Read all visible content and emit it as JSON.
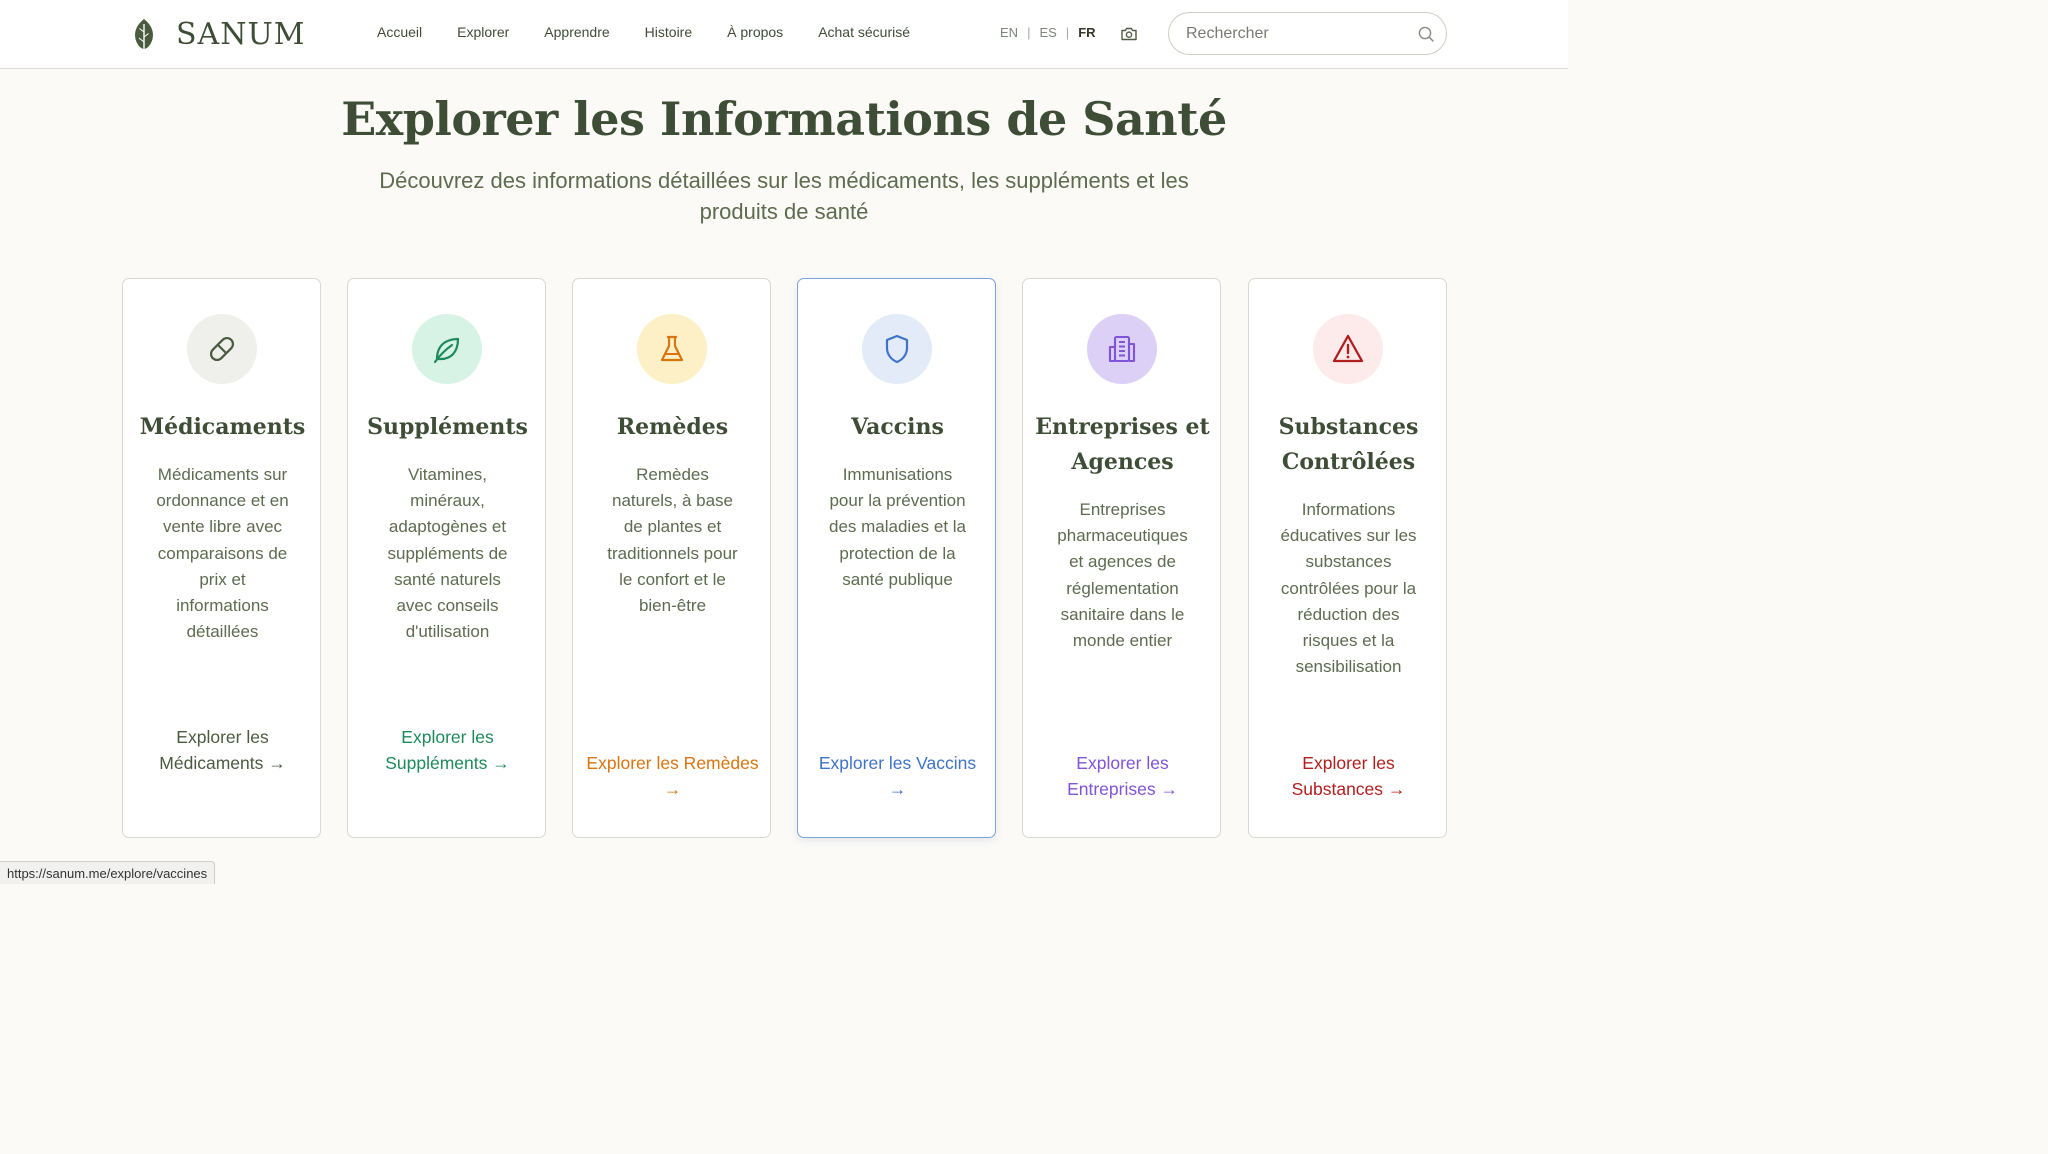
{
  "brand": {
    "name": "SANUM"
  },
  "nav": [
    {
      "label": "Accueil"
    },
    {
      "label": "Explorer"
    },
    {
      "label": "Apprendre"
    },
    {
      "label": "Histoire"
    },
    {
      "label": "À propos"
    },
    {
      "label": "Achat sécurisé"
    }
  ],
  "languages": {
    "en": "EN",
    "es": "ES",
    "fr": "FR",
    "sep": "|",
    "active": "FR"
  },
  "search": {
    "placeholder": "Rechercher",
    "value": ""
  },
  "hero": {
    "title": "Explorer les Informations de Santé",
    "subtitle": "Découvrez des informations détaillées sur les médicaments, les suppléments et les produits de santé"
  },
  "cards": [
    {
      "title": "Médicaments",
      "description": "Médicaments sur ordonnance et en vente libre avec comparaisons de prix et informations détaillées",
      "link": "Explorer les Médicaments →",
      "icon": "pill-icon",
      "color": "#4a5b3f",
      "icon_bg": "#efefec"
    },
    {
      "title": "Suppléments",
      "description": "Vitamines, minéraux, adaptogènes et suppléments de santé naturels avec conseils d'utilisation",
      "link": "Explorer les Suppléments →",
      "icon": "leaf-icon",
      "color": "#1d8a5c",
      "icon_bg": "#d6f3e5"
    },
    {
      "title": "Remèdes",
      "description": "Remèdes naturels, à base de plantes et traditionnels pour le confort et le bien-être",
      "link": "Explorer les Remèdes →",
      "icon": "flask-icon",
      "color": "#d9740f",
      "icon_bg": "#fdf0c6"
    },
    {
      "title": "Vaccins",
      "description": "Immunisations pour la prévention des maladies et la protection de la santé publique",
      "link": "Explorer les Vaccins →",
      "icon": "shield-icon",
      "color": "#3f73c8",
      "icon_bg": "#e3ebf9"
    },
    {
      "title": "Entreprises et Agences",
      "description": "Entreprises pharmaceutiques et agences de réglementation sanitaire dans le monde entier",
      "link": "Explorer les Entreprises →",
      "icon": "building-icon",
      "color": "#8054d6",
      "icon_bg": "#ddd0f6"
    },
    {
      "title": "Substances Contrôlées",
      "description": "Informations éducatives sur les substances contrôlées pour la réduction des risques et la sensibilisation",
      "link": "Explorer les Substances →",
      "icon": "warning-icon",
      "color": "#b01e1e",
      "icon_bg": "#fcebea"
    }
  ],
  "statusbar": {
    "url": "https://sanum.me/explore/vaccines"
  }
}
